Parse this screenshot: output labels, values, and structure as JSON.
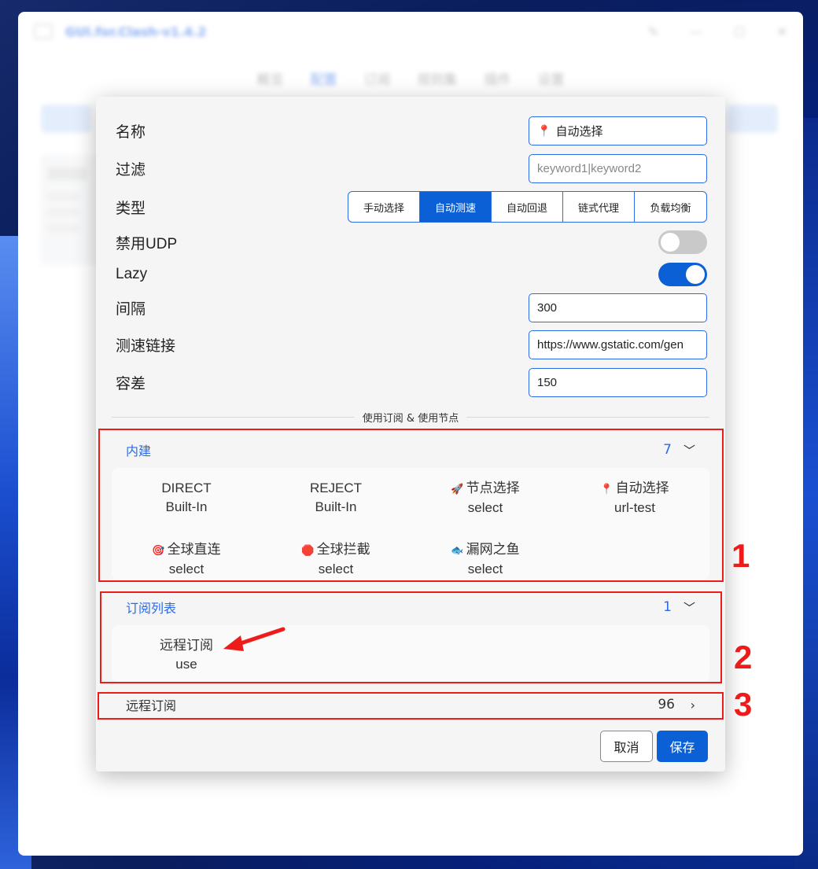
{
  "window": {
    "title": "GUI.for.Clash-v1.4.2",
    "controls": [
      "pin-icon",
      "minimize-icon",
      "maximize-icon",
      "close-icon"
    ]
  },
  "nav": {
    "items": [
      "概览",
      "配置",
      "订阅",
      "规则集",
      "插件",
      "设置"
    ],
    "active_index": 1
  },
  "form": {
    "name_label": "名称",
    "name_value": "自动选择",
    "name_icon": "red-pin-icon",
    "filter_label": "过滤",
    "filter_placeholder": "keyword1|keyword2",
    "type_label": "类型",
    "type_options": [
      "手动选择",
      "自动测速",
      "自动回退",
      "链式代理",
      "负载均衡"
    ],
    "type_selected": "自动测速",
    "udp_label": "禁用UDP",
    "udp_enabled": false,
    "lazy_label": "Lazy",
    "lazy_enabled": true,
    "interval_label": "间隔",
    "interval_value": "300",
    "url_label": "测速链接",
    "url_value": "https://www.gstatic.com/gen",
    "tolerance_label": "容差",
    "tolerance_value": "150"
  },
  "divider_text": "使用订阅 & 使用节点",
  "builtin": {
    "title": "内建",
    "count": "7",
    "nodes": [
      {
        "emoji": "",
        "name": "DIRECT",
        "type": "Built-In"
      },
      {
        "emoji": "",
        "name": "REJECT",
        "type": "Built-In"
      },
      {
        "emoji": "🚀",
        "name": "节点选择",
        "type": "select"
      },
      {
        "emoji": "📍",
        "name": "自动选择",
        "type": "url-test"
      },
      {
        "emoji": "🎯",
        "name": "全球直连",
        "type": "select"
      },
      {
        "emoji": "🛑",
        "name": "全球拦截",
        "type": "select"
      },
      {
        "emoji": "🐟",
        "name": "漏网之鱼",
        "type": "select"
      }
    ]
  },
  "subscriptions": {
    "title": "订阅列表",
    "count": "1",
    "nodes": [
      {
        "name": "远程订阅",
        "type": "use"
      }
    ]
  },
  "remote": {
    "title": "远程订阅",
    "count": "96"
  },
  "buttons": {
    "cancel": "取消",
    "save": "保存"
  },
  "annotations": [
    "1",
    "2",
    "3"
  ],
  "colors": {
    "accent": "#0c60d6",
    "annotation": "#ee1b1b"
  }
}
